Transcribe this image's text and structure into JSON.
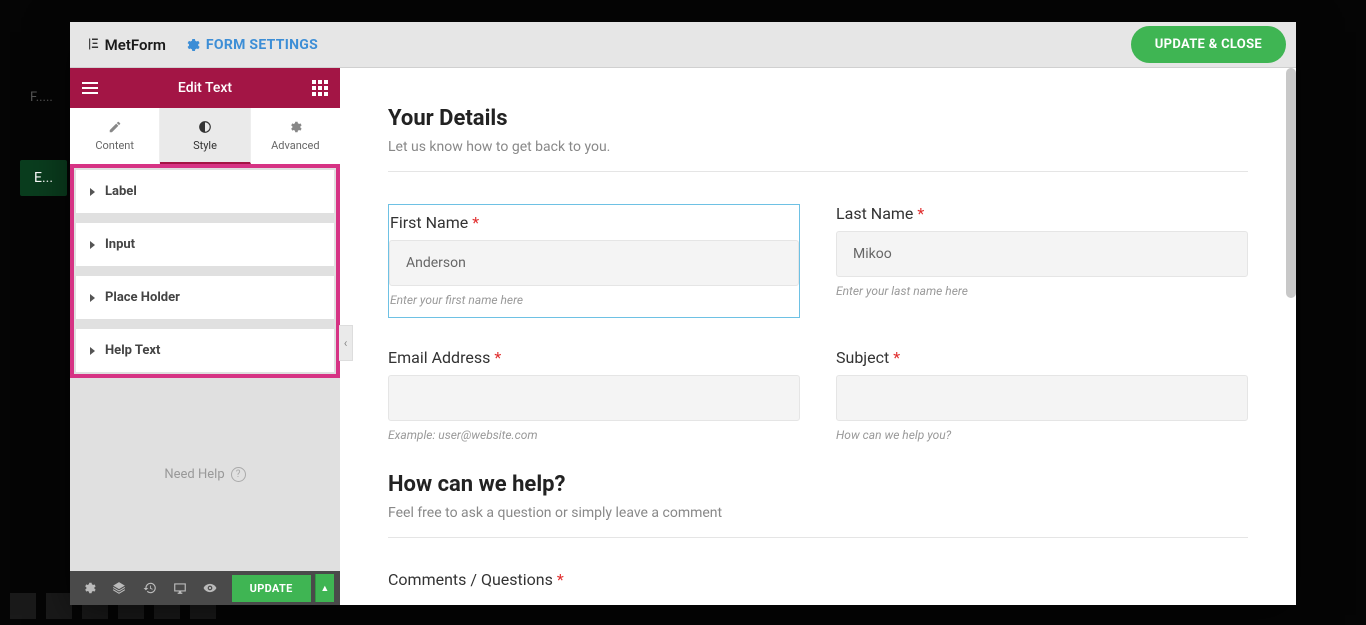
{
  "topbar": {
    "logo": "MetForm",
    "form_settings": "FORM SETTINGS",
    "update_close": "UPDATE & CLOSE"
  },
  "sidebar": {
    "edit_title": "Edit Text",
    "tabs": {
      "content": "Content",
      "style": "Style",
      "advanced": "Advanced"
    },
    "accordion": [
      "Label",
      "Input",
      "Place Holder",
      "Help Text"
    ],
    "need_help": "Need Help",
    "footer": {
      "update": "UPDATE"
    }
  },
  "form": {
    "section1": {
      "title": "Your Details",
      "sub": "Let us know how to get back to you."
    },
    "first_name": {
      "label": "First Name",
      "value": "Anderson",
      "hint": "Enter your first name here"
    },
    "last_name": {
      "label": "Last Name",
      "value": "Mikoo",
      "hint": "Enter your last name here"
    },
    "email": {
      "label": "Email Address",
      "hint": "Example: user@website.com"
    },
    "subject": {
      "label": "Subject",
      "hint": "How can we help you?"
    },
    "section2": {
      "title": "How can we help?",
      "sub": "Feel free to ask a question or simply leave a comment"
    },
    "comments": {
      "label": "Comments / Questions"
    }
  },
  "background": {
    "hint_line1": "F",
    "btn": "E"
  }
}
